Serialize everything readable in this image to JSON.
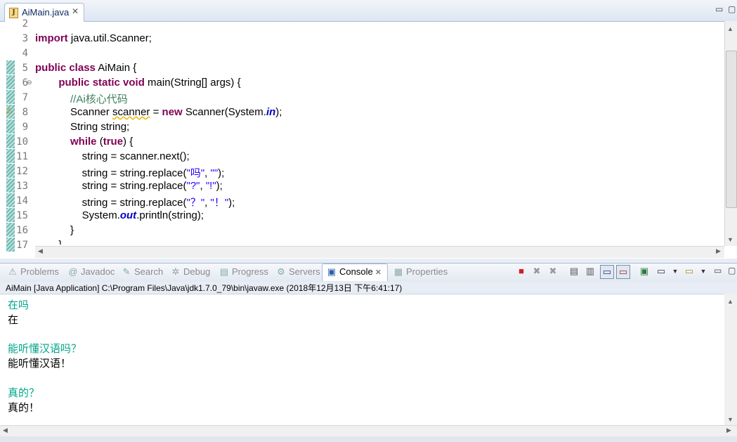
{
  "editor": {
    "tab_label": "AiMain.java",
    "lines": [
      {
        "num": "2",
        "segments": []
      },
      {
        "num": "3",
        "segments": [
          {
            "t": "import",
            "c": "kw"
          },
          {
            "t": " java.util.Scanner;"
          }
        ]
      },
      {
        "num": "4",
        "segments": []
      },
      {
        "num": "5",
        "segments": [
          {
            "t": "public",
            "c": "kw"
          },
          {
            "t": " "
          },
          {
            "t": "class",
            "c": "kw"
          },
          {
            "t": " AiMain {"
          }
        ]
      },
      {
        "num": "6",
        "segments": [
          {
            "t": "        "
          },
          {
            "t": "public",
            "c": "kw"
          },
          {
            "t": " "
          },
          {
            "t": "static",
            "c": "kw"
          },
          {
            "t": " "
          },
          {
            "t": "void",
            "c": "kw"
          },
          {
            "t": " main(String[] args) {"
          }
        ]
      },
      {
        "num": "7",
        "segments": [
          {
            "t": "            "
          },
          {
            "t": "//Ai核心代码",
            "c": "cm"
          }
        ]
      },
      {
        "num": "8",
        "segments": [
          {
            "t": "            Scanner "
          },
          {
            "t": "scanner",
            "c": "warnul"
          },
          {
            "t": " = "
          },
          {
            "t": "new",
            "c": "kw"
          },
          {
            "t": " Scanner(System."
          },
          {
            "t": "in",
            "c": "fd"
          },
          {
            "t": ");"
          }
        ]
      },
      {
        "num": "9",
        "segments": [
          {
            "t": "            String string;"
          }
        ]
      },
      {
        "num": "10",
        "segments": [
          {
            "t": "            "
          },
          {
            "t": "while",
            "c": "kw"
          },
          {
            "t": " ("
          },
          {
            "t": "true",
            "c": "kw"
          },
          {
            "t": ") {"
          }
        ]
      },
      {
        "num": "11",
        "segments": [
          {
            "t": "                string = scanner.next();"
          }
        ]
      },
      {
        "num": "12",
        "segments": [
          {
            "t": "                string = string.replace("
          },
          {
            "t": "\"吗\"",
            "c": "st"
          },
          {
            "t": ", "
          },
          {
            "t": "\"\"",
            "c": "st"
          },
          {
            "t": ");"
          }
        ]
      },
      {
        "num": "13",
        "segments": [
          {
            "t": "                string = string.replace("
          },
          {
            "t": "\"?\"",
            "c": "st"
          },
          {
            "t": ", "
          },
          {
            "t": "\"!\"",
            "c": "st"
          },
          {
            "t": ");"
          }
        ]
      },
      {
        "num": "14",
        "segments": [
          {
            "t": "                string = string.replace("
          },
          {
            "t": "\"？\"",
            "c": "st"
          },
          {
            "t": ", "
          },
          {
            "t": "\"！\"",
            "c": "st"
          },
          {
            "t": ");"
          }
        ]
      },
      {
        "num": "15",
        "segments": [
          {
            "t": "                System."
          },
          {
            "t": "out",
            "c": "fd"
          },
          {
            "t": ".println(string);"
          }
        ]
      },
      {
        "num": "16",
        "segments": [
          {
            "t": "            }"
          }
        ]
      },
      {
        "num": "17",
        "segments": [
          {
            "t": "        }"
          }
        ]
      }
    ]
  },
  "views": {
    "tabs": [
      {
        "label": "Problems",
        "icon": "problems-icon",
        "glyph": "⚠"
      },
      {
        "label": "Javadoc",
        "icon": "javadoc-icon",
        "glyph": "@"
      },
      {
        "label": "Search",
        "icon": "search-icon",
        "glyph": "✎"
      },
      {
        "label": "Debug",
        "icon": "debug-icon",
        "glyph": "✲"
      },
      {
        "label": "Progress",
        "icon": "progress-icon",
        "glyph": "▤"
      },
      {
        "label": "Servers",
        "icon": "servers-icon",
        "glyph": "⚙"
      },
      {
        "label": "Console",
        "icon": "console-icon",
        "glyph": "▣",
        "active": true
      },
      {
        "label": "Properties",
        "icon": "properties-icon",
        "glyph": "▦"
      }
    ]
  },
  "console": {
    "launch": "AiMain [Java Application] C:\\Program Files\\Java\\jdk1.7.0_79\\bin\\javaw.exe (2018年12月13日 下午6:41:17)",
    "output": [
      {
        "text": "在吗",
        "kind": "in"
      },
      {
        "text": "在",
        "kind": "sys"
      },
      {
        "text": "",
        "kind": "sys"
      },
      {
        "text": "能听懂汉语吗？",
        "kind": "in"
      },
      {
        "text": "能听懂汉语！",
        "kind": "sys"
      },
      {
        "text": "",
        "kind": "sys"
      },
      {
        "text": "真的？",
        "kind": "in"
      },
      {
        "text": "真的！",
        "kind": "sys"
      }
    ]
  },
  "colors": {
    "keyword": "#7f0055",
    "comment": "#3f7f5f",
    "string": "#2a00ff",
    "field": "#0000c0",
    "console_input": "#00a68a"
  }
}
